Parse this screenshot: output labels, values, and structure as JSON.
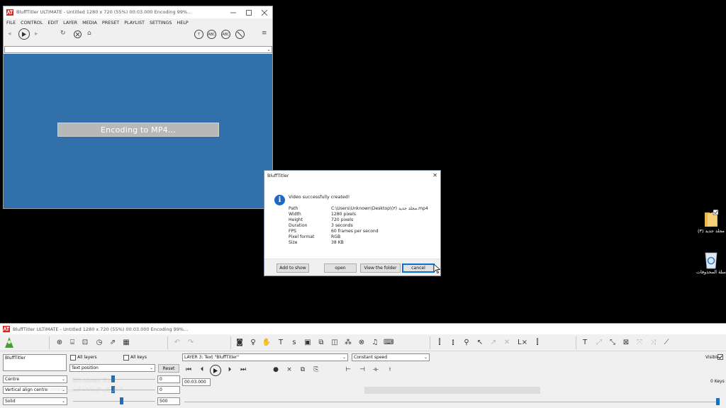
{
  "main_window": {
    "title": "BluffTitler ULTIMATE  -  Untitled 1280 x 720 (55%) 00:03.000 Encoding 99%...",
    "menu": [
      "FILE",
      "CONTROL",
      "EDIT",
      "LAYER",
      "MEDIA",
      "PRESET",
      "PLAYLIST",
      "SETTINGS",
      "HELP"
    ],
    "toolbar_round_labels": [
      "T",
      "ABC",
      "ABC",
      ""
    ],
    "encoding_text": "Encoding to MP4..."
  },
  "dialog": {
    "title": "BluffTitler",
    "headline": "Video successfully created!",
    "rows": [
      {
        "key": "Path",
        "value": "C:\\Users\\Unknown\\Desktop\\(٣) مجلد جديد.mp4"
      },
      {
        "key": "Width",
        "value": "1280 pixels"
      },
      {
        "key": "Height",
        "value": "720 pixels"
      },
      {
        "key": "Duration",
        "value": "3 seconds"
      },
      {
        "key": "FPS",
        "value": "60 frames per second"
      },
      {
        "key": "Pixel format",
        "value": "RGB"
      },
      {
        "key": "Size",
        "value": "38 KB"
      }
    ],
    "buttons": {
      "add_to_show": "Add to show",
      "open": "open",
      "view_folder": "View the folder",
      "cancel": "cancel"
    }
  },
  "desktop": {
    "folder_label": "(٣) مجلد جديد",
    "recycle_label": "سلة المحذوفات"
  },
  "control_window": {
    "title": "BluffTitler ULTIMATE  -  Untitled 1280 x 720 (55%) 00:03.000 Encoding 99%...",
    "layer_name": "BluffTitler",
    "all_layers": "All layers",
    "all_keys": "All keys",
    "property_select": "Text position",
    "reset": "Reset",
    "align_select": "Centre",
    "valign_select": "Vertical align centre",
    "fill_select": "Solid",
    "value1": "0",
    "value2": "0",
    "value3": "500",
    "layer_select": "LAYER 3: Text \"BluffTitler\"",
    "speed_select": "Constant speed",
    "time": "00:03.000",
    "visible": "Visible",
    "keys_count": "0 Keys",
    "watermark_line1": "Windows Ba...",
    "watermark_line2": "Windows الحال إلى الإعدادات لتنشيط"
  }
}
